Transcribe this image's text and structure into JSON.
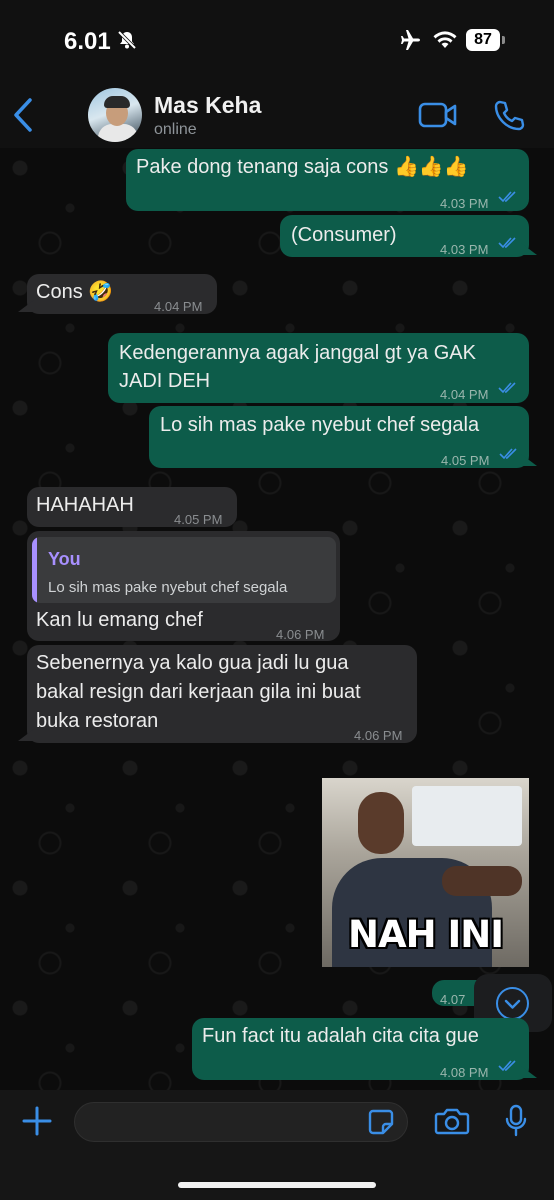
{
  "status": {
    "time": "6.01",
    "battery": "87"
  },
  "contact": {
    "name": "Mas Keha",
    "status": "online"
  },
  "messages": [
    {
      "text": "Pake dong tenang saja cons 👍👍👍",
      "time": "4.03 PM"
    },
    {
      "text": "(Consumer)",
      "time": "4.03 PM"
    },
    {
      "text": "Cons 🤣",
      "time": "4.04 PM"
    },
    {
      "line1": "Kedengerannya agak janggal gt ya GAK",
      "line2": "JADI DEH",
      "time": "4.04 PM"
    },
    {
      "text": "Lo sih mas pake nyebut chef segala",
      "time": "4.05 PM"
    },
    {
      "text": "HAHAHAH",
      "time": "4.05 PM"
    },
    {
      "quote_author": "You",
      "quote_text": "Lo sih mas pake nyebut chef segala",
      "text": "Kan lu emang chef",
      "time": "4.06 PM"
    },
    {
      "line1": "Sebenernya ya kalo gua jadi lu gua",
      "line2": "bakal resign dari kerjaan gila ini buat",
      "line3": "buka restoran",
      "time": "4.06 PM"
    },
    {
      "sticker_caption": "NAH INI",
      "time": "4.07"
    },
    {
      "text": "Fun fact itu adalah cita cita gue",
      "time": "4.08 PM"
    }
  ],
  "colors": {
    "accent": "#3a8ee6",
    "outgoing": "#0d5c4a",
    "incoming": "#2b2b2d",
    "quote_author": "#a890ff"
  },
  "icons": [
    "back-chevron-icon",
    "video-call-icon",
    "phone-icon",
    "scroll-down-icon",
    "plus-icon",
    "sticker-icon",
    "camera-icon",
    "microphone-icon",
    "double-check-icon"
  ]
}
